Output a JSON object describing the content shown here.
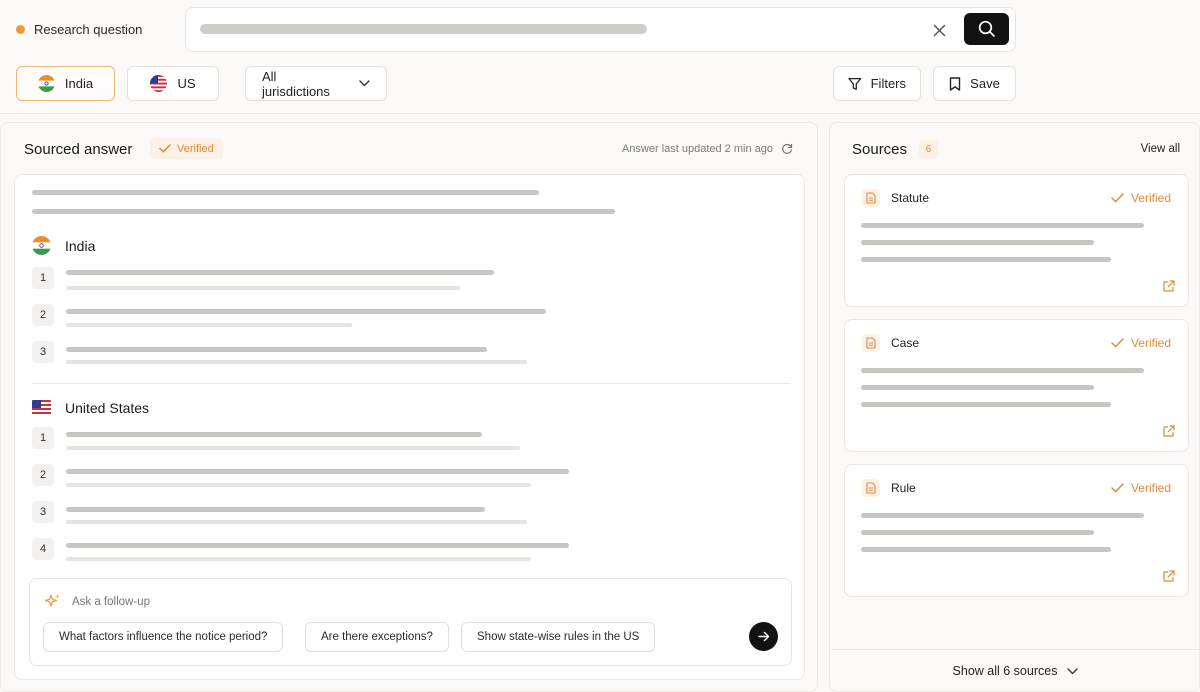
{
  "header": {
    "research_label": "Research question",
    "accent_color": "#ef9a3a"
  },
  "filters": {
    "india_label": "India",
    "us_label": "US",
    "jurisdictions_label": "All jurisdictions",
    "filters_label": "Filters",
    "save_label": "Save"
  },
  "answer": {
    "title": "Sourced answer",
    "verified_label": "Verified",
    "updated_text": "Answer last updated 2 min ago",
    "sections": [
      {
        "title": "India",
        "points": [
          "1",
          "2",
          "3"
        ]
      },
      {
        "title": "United States",
        "points": [
          "1",
          "2",
          "3",
          "4"
        ]
      }
    ]
  },
  "followup": {
    "placeholder": "Ask a follow-up",
    "suggestions": [
      "What factors influence the notice period?",
      "Are there exceptions?",
      "Show state-wise rules in the US"
    ]
  },
  "sources": {
    "title": "Sources",
    "count": "6",
    "view_all_label": "View all",
    "items": [
      {
        "type": "Statute",
        "status": "Verified"
      },
      {
        "type": "Case",
        "status": "Verified"
      },
      {
        "type": "Rule",
        "status": "Verified"
      }
    ],
    "show_all_label": "Show all 6 sources"
  }
}
